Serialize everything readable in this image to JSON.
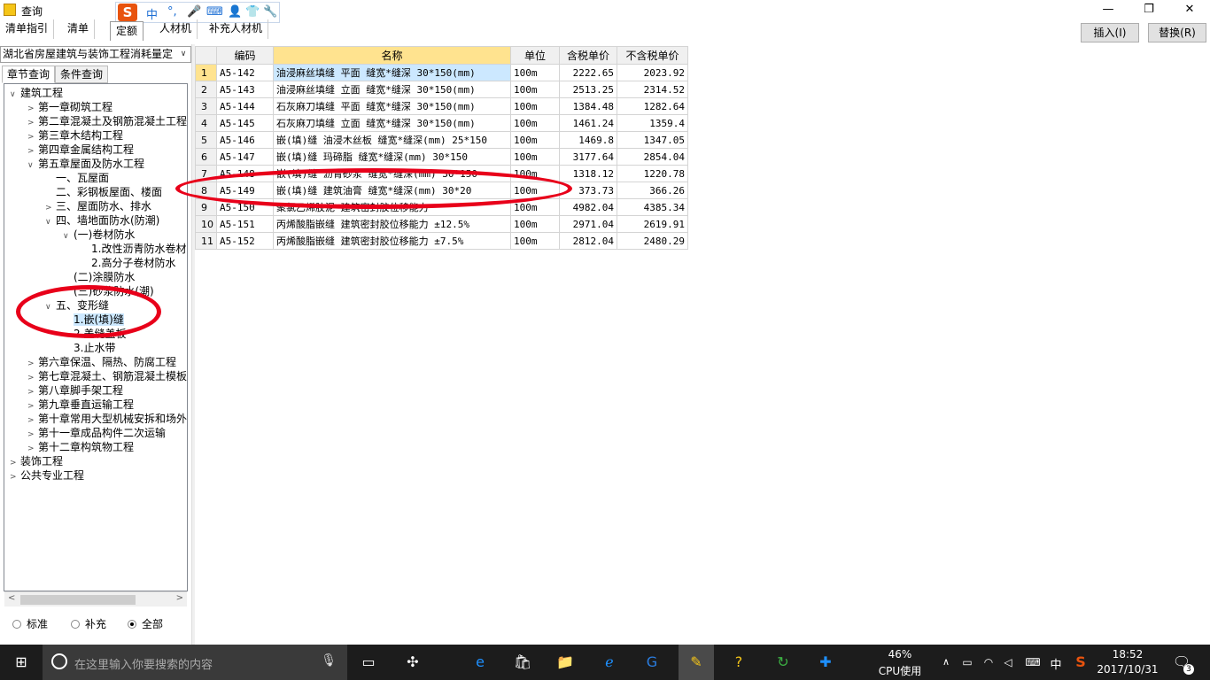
{
  "window": {
    "title": "查询",
    "min": "—",
    "max": "❐",
    "close": "✕"
  },
  "ime": {
    "logo": "S",
    "mode": "中",
    "punct": "°,",
    "voice": "🎤",
    "keyboard": "⌨",
    "user": "👤",
    "skin": "👕",
    "tools": "🔧"
  },
  "top_tabs": [
    "清单指引",
    "清单",
    "定额",
    "人材机",
    "补充人材机"
  ],
  "buttons": {
    "insert": "插入(I)",
    "replace": "替换(R)"
  },
  "combo": {
    "value": "湖北省房屋建筑与装饰工程消耗量定"
  },
  "sub_tabs": [
    "章节查询",
    "条件查询"
  ],
  "tree": [
    {
      "label": "建筑工程",
      "depth": 0,
      "exp": "∨"
    },
    {
      "label": "第一章砌筑工程",
      "depth": 1,
      "exp": ">"
    },
    {
      "label": "第二章混凝土及钢筋混凝土工程",
      "depth": 1,
      "exp": ">"
    },
    {
      "label": "第三章木结构工程",
      "depth": 1,
      "exp": ">"
    },
    {
      "label": "第四章金属结构工程",
      "depth": 1,
      "exp": ">"
    },
    {
      "label": "第五章屋面及防水工程",
      "depth": 1,
      "exp": "∨"
    },
    {
      "label": "一、瓦屋面",
      "depth": 2,
      "exp": ""
    },
    {
      "label": "二、彩钢板屋面、楼面",
      "depth": 2,
      "exp": ""
    },
    {
      "label": "三、屋面防水、排水",
      "depth": 2,
      "exp": ">"
    },
    {
      "label": "四、墙地面防水(防潮)",
      "depth": 2,
      "exp": "∨"
    },
    {
      "label": "(一)卷材防水",
      "depth": 3,
      "exp": "∨"
    },
    {
      "label": "1.改性沥青防水卷材",
      "depth": 4,
      "exp": ""
    },
    {
      "label": "2.高分子卷材防水",
      "depth": 4,
      "exp": ""
    },
    {
      "label": "(二)涂膜防水",
      "depth": 3,
      "exp": ""
    },
    {
      "label": "(三)砂浆防水(潮)",
      "depth": 3,
      "exp": ""
    },
    {
      "label": "五、变形缝",
      "depth": 2,
      "exp": "∨"
    },
    {
      "label": "1.嵌(填)缝",
      "depth": 3,
      "exp": "",
      "selected": true
    },
    {
      "label": "2.盖缝盖板",
      "depth": 3,
      "exp": ""
    },
    {
      "label": "3.止水带",
      "depth": 3,
      "exp": ""
    },
    {
      "label": "第六章保温、隔热、防腐工程",
      "depth": 1,
      "exp": ">"
    },
    {
      "label": "第七章混凝土、钢筋混凝土模板",
      "depth": 1,
      "exp": ">"
    },
    {
      "label": "第八章脚手架工程",
      "depth": 1,
      "exp": ">"
    },
    {
      "label": "第九章垂直运输工程",
      "depth": 1,
      "exp": ">"
    },
    {
      "label": "第十章常用大型机械安拆和场外",
      "depth": 1,
      "exp": ">"
    },
    {
      "label": "第十一章成品构件二次运输",
      "depth": 1,
      "exp": ">"
    },
    {
      "label": "第十二章构筑物工程",
      "depth": 1,
      "exp": ">"
    },
    {
      "label": "装饰工程",
      "depth": 0,
      "exp": ">"
    },
    {
      "label": "公共专业工程",
      "depth": 0,
      "exp": ">"
    }
  ],
  "radios": [
    {
      "label": "标准",
      "checked": false
    },
    {
      "label": "补充",
      "checked": false
    },
    {
      "label": "全部",
      "checked": true
    }
  ],
  "grid": {
    "headers": [
      "",
      "编码",
      "名称",
      "单位",
      "含税单价",
      "不含税单价"
    ],
    "rows": [
      [
        "1",
        "A5-142",
        "油浸麻丝填缝 平面 缝宽*缝深 30*150(mm)",
        "100m",
        "2222.65",
        "2023.92"
      ],
      [
        "2",
        "A5-143",
        "油浸麻丝填缝 立面 缝宽*缝深 30*150(mm)",
        "100m",
        "2513.25",
        "2314.52"
      ],
      [
        "3",
        "A5-144",
        "石灰麻刀填缝 平面 缝宽*缝深 30*150(mm)",
        "100m",
        "1384.48",
        "1282.64"
      ],
      [
        "4",
        "A5-145",
        "石灰麻刀填缝 立面 缝宽*缝深 30*150(mm)",
        "100m",
        "1461.24",
        "1359.4"
      ],
      [
        "5",
        "A5-146",
        "嵌(填)缝 油浸木丝板 缝宽*缝深(mm) 25*150",
        "100m",
        "1469.8",
        "1347.05"
      ],
      [
        "6",
        "A5-147",
        "嵌(填)缝 玛碲脂 缝宽*缝深(mm) 30*150",
        "100m",
        "3177.64",
        "2854.04"
      ],
      [
        "7",
        "A5-148",
        "嵌(填)缝 沥青砂浆 缝宽*缝深(mm) 30*150",
        "100m",
        "1318.12",
        "1220.78"
      ],
      [
        "8",
        "A5-149",
        "嵌(填)缝 建筑油膏 缝宽*缝深(mm) 30*20",
        "100m",
        "373.73",
        "366.26"
      ],
      [
        "9",
        "A5-150",
        "聚氯乙烯胶泥 建筑密封胶位移能力",
        "100m",
        "4982.04",
        "4385.34"
      ],
      [
        "10",
        "A5-151",
        "丙烯酸脂嵌缝 建筑密封胶位移能力 ±12.5%",
        "100m",
        "2971.04",
        "2619.91"
      ],
      [
        "11",
        "A5-152",
        "丙烯酸脂嵌缝 建筑密封胶位移能力 ±7.5%",
        "100m",
        "2812.04",
        "2480.29"
      ]
    ]
  },
  "taskbar": {
    "search_placeholder": "在这里输入你要搜索的内容",
    "cpu_percent": "46%",
    "cpu_label": "CPU使用",
    "ime_indicator": "中",
    "time": "18:52",
    "date": "2017/10/31",
    "notif_count": "3"
  }
}
